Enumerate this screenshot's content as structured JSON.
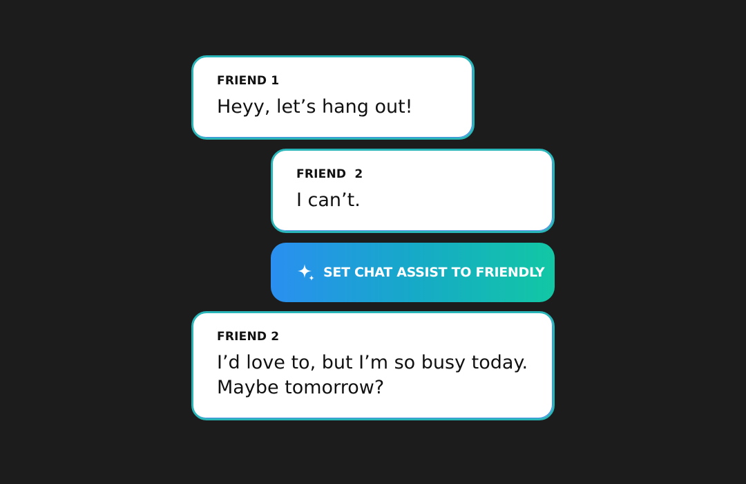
{
  "messages": [
    {
      "sender": "FRIEND 1",
      "text": "Heyy, let’s hang out!"
    },
    {
      "sender": "FRIEND  2",
      "text": "I can’t."
    },
    {
      "sender": "FRIEND 2",
      "text": "I’d love to, but I’m so busy today. Maybe tomorrow?"
    }
  ],
  "assist_button": {
    "label": "SET CHAT ASSIST TO FRIENDLY",
    "icon": "sparkle-icon"
  },
  "colors": {
    "background": "#1c1c1c",
    "bubble_fill": "#ffffff",
    "bubble_border": "#2ab5b8",
    "button_gradient_start": "#2a8ff0",
    "button_gradient_end": "#12c7a4",
    "text": "#111111"
  }
}
